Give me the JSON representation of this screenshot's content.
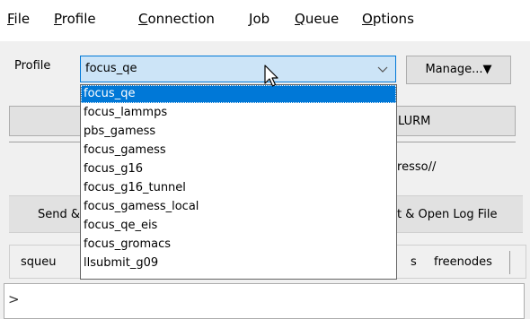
{
  "menu": [
    {
      "mnemonic": "F",
      "rest": "ile"
    },
    {
      "mnemonic": "P",
      "rest": "rofile"
    },
    {
      "mnemonic": "C",
      "rest": "onnection"
    },
    {
      "mnemonic": "J",
      "rest": "ob"
    },
    {
      "mnemonic": "Q",
      "rest": "ueue"
    },
    {
      "mnemonic": "O",
      "rest": "ptions"
    }
  ],
  "profile": {
    "label": "Profile",
    "selected": "focus_qe",
    "manage_label": "Manage...▼",
    "options": [
      "focus_qe",
      "focus_lammps",
      "pbs_gamess",
      "focus_gamess",
      "focus_g16",
      "focus_g16_tunnel",
      "focus_gamess_local",
      "focus_qe_eis",
      "focus_gromacs",
      "llsubmit_g09"
    ]
  },
  "background": {
    "slurm_text": "LURM",
    "espresso_text": "spresso//",
    "send_text": "Send &",
    "open_log_text": "t & Open Log File",
    "tabs": {
      "squeue": "squeu",
      "s": "s",
      "freenodes": "freenodes"
    }
  },
  "console": {
    "prompt": ">"
  }
}
